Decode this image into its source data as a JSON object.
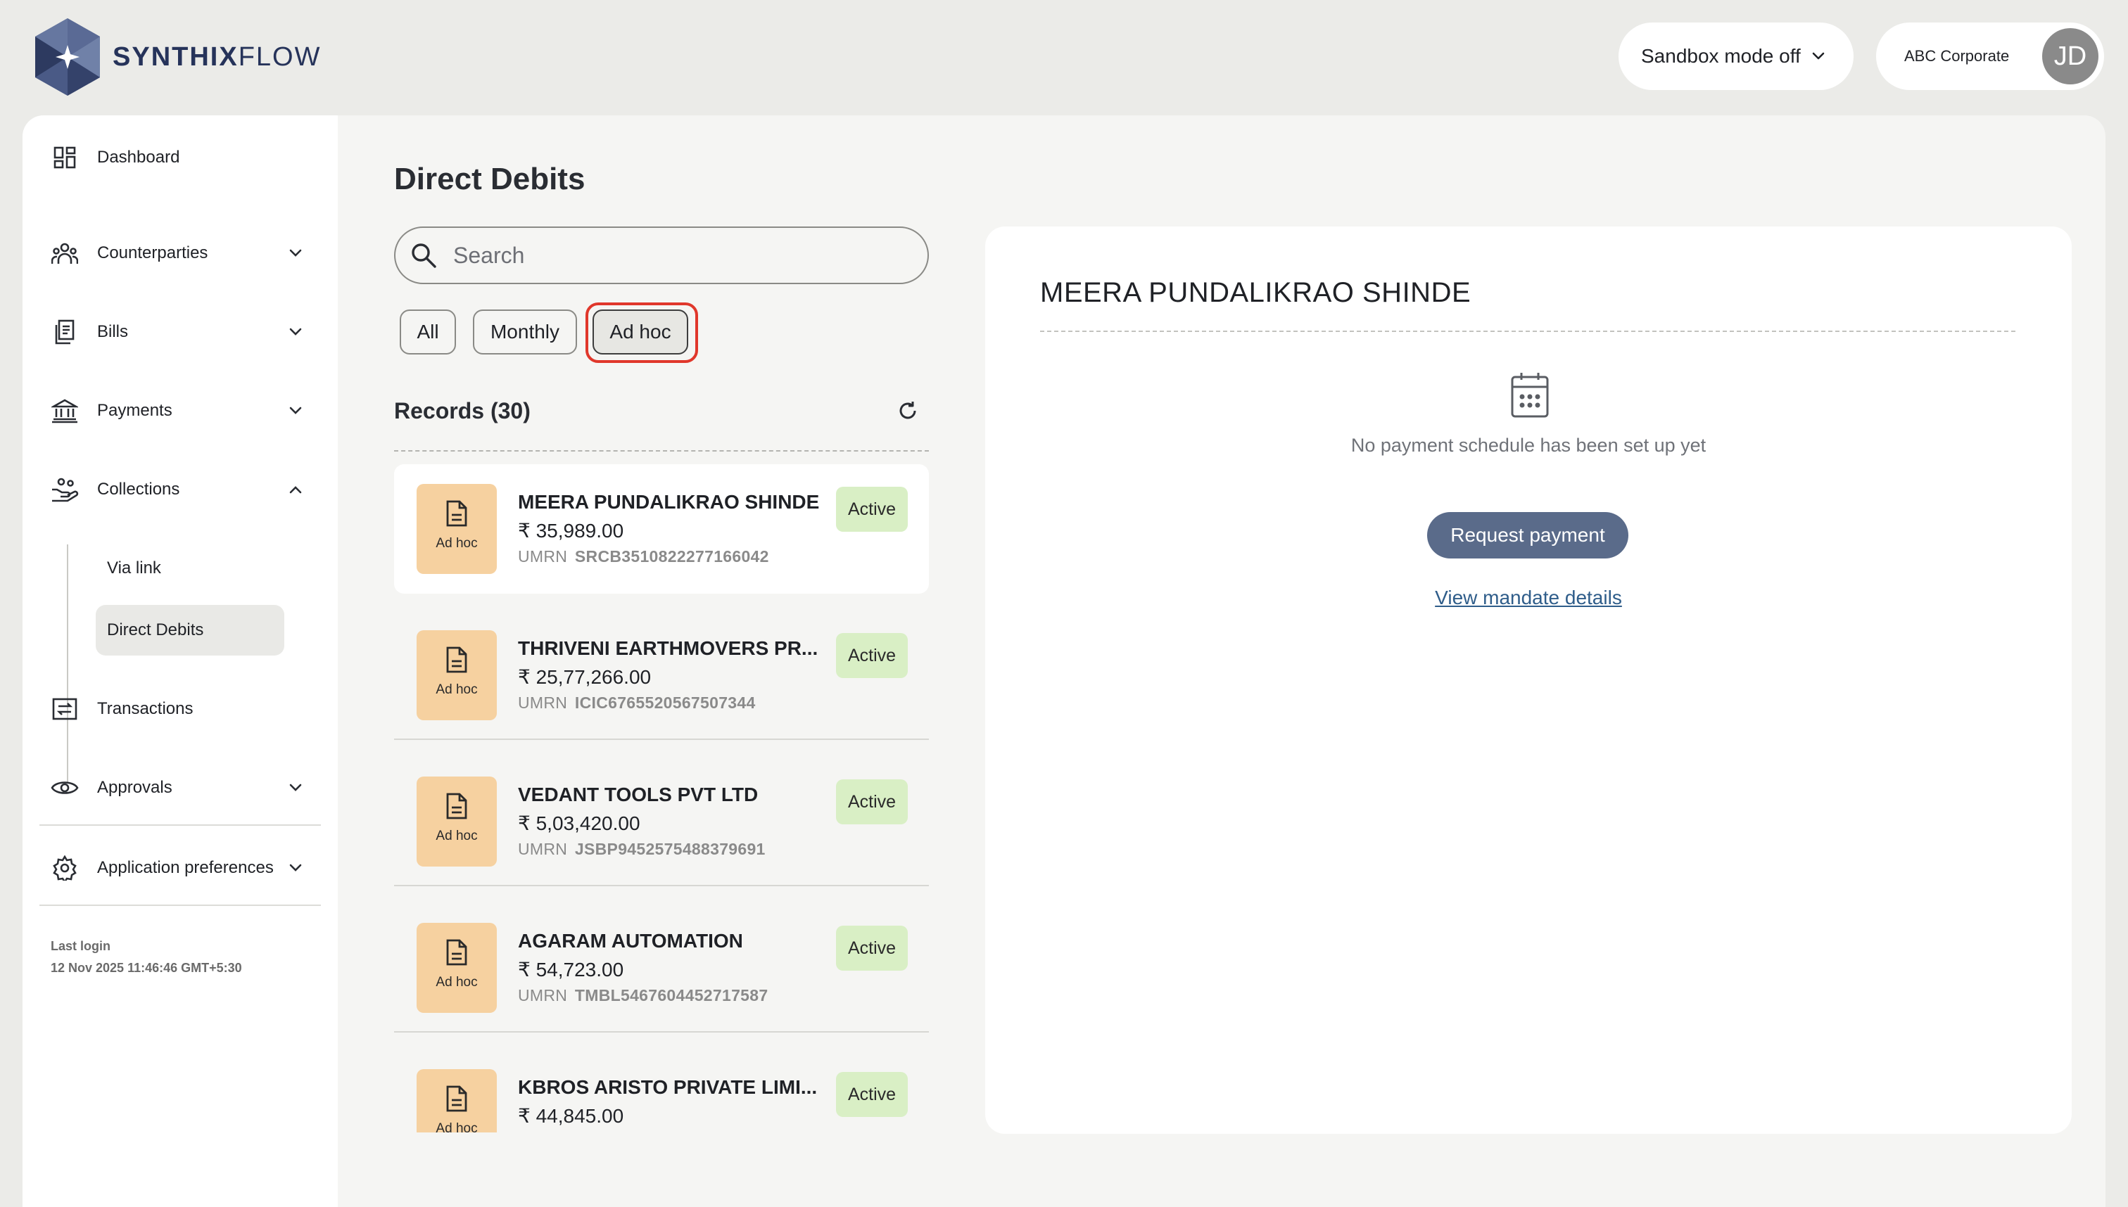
{
  "brand": {
    "name_bold": "SYNTHIX",
    "name_light": "FLOW"
  },
  "header": {
    "sandbox_label": "Sandbox mode off",
    "corporate": "ABC Corporate",
    "avatar_initials": "JD"
  },
  "sidebar": {
    "items": [
      {
        "label": "Dashboard",
        "icon": "dashboard-icon"
      },
      {
        "label": "Counterparties",
        "icon": "people-icon"
      },
      {
        "label": "Bills",
        "icon": "bills-icon"
      },
      {
        "label": "Payments",
        "icon": "bank-icon"
      },
      {
        "label": "Collections",
        "icon": "collections-icon"
      },
      {
        "label": "Transactions",
        "icon": "transactions-icon"
      },
      {
        "label": "Approvals",
        "icon": "eye-icon"
      },
      {
        "label": "Application preferences",
        "icon": "gear-icon"
      }
    ],
    "collections_sub": [
      {
        "label": "Via link"
      },
      {
        "label": "Direct Debits"
      }
    ],
    "last_login_label": "Last login",
    "last_login_value": "12 Nov 2025 11:46:46 GMT+5:30"
  },
  "main": {
    "title": "Direct Debits",
    "search_placeholder": "Search",
    "filters": [
      {
        "label": "All"
      },
      {
        "label": "Monthly"
      },
      {
        "label": "Ad hoc",
        "selected": true
      }
    ],
    "records_title": "Records (30)",
    "records": [
      {
        "type": "Ad hoc",
        "name": "MEERA PUNDALIKRAO SHINDE",
        "amount": "₹ 35,989.00",
        "umrn_label": "UMRN",
        "umrn": "SRCB3510822277166042",
        "status": "Active"
      },
      {
        "type": "Ad hoc",
        "name": "THRIVENI EARTHMOVERS PR...",
        "amount": "₹ 25,77,266.00",
        "umrn_label": "UMRN",
        "umrn": "ICIC6765520567507344",
        "status": "Active"
      },
      {
        "type": "Ad hoc",
        "name": "VEDANT TOOLS PVT LTD",
        "amount": "₹ 5,03,420.00",
        "umrn_label": "UMRN",
        "umrn": "JSBP9452575488379691",
        "status": "Active"
      },
      {
        "type": "Ad hoc",
        "name": "AGARAM AUTOMATION",
        "amount": "₹ 54,723.00",
        "umrn_label": "UMRN",
        "umrn": "TMBL5467604452717587",
        "status": "Active"
      },
      {
        "type": "Ad hoc",
        "name": "KBROS ARISTO PRIVATE LIMI...",
        "amount": "₹ 44,845.00",
        "umrn_label": "",
        "umrn": "",
        "status": "Active"
      }
    ]
  },
  "detail": {
    "name": "MEERA PUNDALIKRAO SHINDE",
    "empty_message": "No payment schedule has been set up yet",
    "request_button": "Request payment",
    "view_link": "View mandate details"
  },
  "colors": {
    "background": "#ebebe8",
    "active_badge": "#d9efc5",
    "doc_tile": "#f6d1a0",
    "primary_button": "#5a6b8a",
    "highlight": "#e0372b",
    "link": "#2f5d8a"
  }
}
